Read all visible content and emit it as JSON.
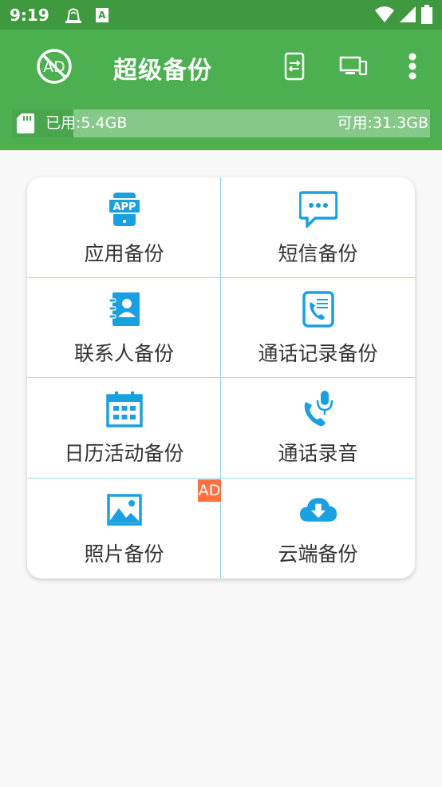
{
  "status_bar": {
    "time": "9:19",
    "sim_label": "A"
  },
  "app_bar": {
    "title": "超级备份",
    "ad_toggle_text": "AD"
  },
  "storage": {
    "used_label": "已用:5.4GB",
    "free_label": "可用:31.3GB",
    "used_fraction": 0.147
  },
  "grid": {
    "items": [
      {
        "label": "应用备份",
        "icon": "app-icon"
      },
      {
        "label": "短信备份",
        "icon": "sms-icon"
      },
      {
        "label": "联系人备份",
        "icon": "contacts-icon"
      },
      {
        "label": "通话记录备份",
        "icon": "call-log-icon"
      },
      {
        "label": "日历活动备份",
        "icon": "calendar-icon"
      },
      {
        "label": "通话录音",
        "icon": "call-recording-icon"
      },
      {
        "label": "照片备份",
        "icon": "photo-icon"
      },
      {
        "label": "云端备份",
        "icon": "cloud-download-icon"
      }
    ],
    "badge": "AD",
    "app_icon_text": "APP"
  },
  "colors": {
    "status_bar": "#3f9a3f",
    "app_bar": "#4caf50",
    "icon_blue": "#1aa0e0",
    "badge": "#ff7043"
  }
}
